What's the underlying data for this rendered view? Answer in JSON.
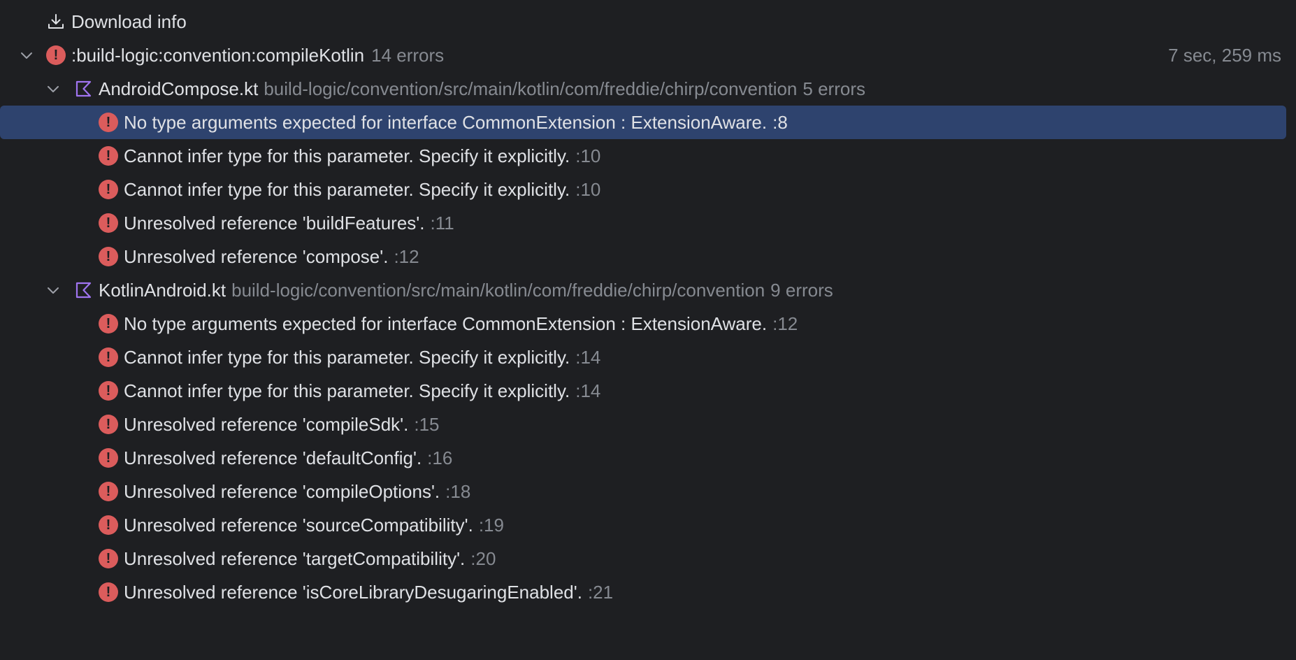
{
  "download": {
    "label": "Download info"
  },
  "task": {
    "name": ":build-logic:convention:compileKotlin",
    "count": "14 errors",
    "duration": "7 sec, 259 ms"
  },
  "files": [
    {
      "name": "AndroidCompose.kt",
      "path": "build-logic/convention/src/main/kotlin/com/freddie/chirp/convention",
      "count": "5 errors",
      "errors": [
        {
          "message": "No type arguments expected for interface CommonExtension : ExtensionAware.",
          "line": ":8"
        },
        {
          "message": "Cannot infer type for this parameter. Specify it explicitly.",
          "line": ":10"
        },
        {
          "message": "Cannot infer type for this parameter. Specify it explicitly.",
          "line": ":10"
        },
        {
          "message": "Unresolved reference 'buildFeatures'.",
          "line": ":11"
        },
        {
          "message": "Unresolved reference 'compose'.",
          "line": ":12"
        }
      ]
    },
    {
      "name": "KotlinAndroid.kt",
      "path": "build-logic/convention/src/main/kotlin/com/freddie/chirp/convention",
      "count": "9 errors",
      "errors": [
        {
          "message": "No type arguments expected for interface CommonExtension : ExtensionAware.",
          "line": ":12"
        },
        {
          "message": "Cannot infer type for this parameter. Specify it explicitly.",
          "line": ":14"
        },
        {
          "message": "Cannot infer type for this parameter. Specify it explicitly.",
          "line": ":14"
        },
        {
          "message": "Unresolved reference 'compileSdk'.",
          "line": ":15"
        },
        {
          "message": "Unresolved reference 'defaultConfig'.",
          "line": ":16"
        },
        {
          "message": "Unresolved reference 'compileOptions'.",
          "line": ":18"
        },
        {
          "message": "Unresolved reference 'sourceCompatibility'.",
          "line": ":19"
        },
        {
          "message": "Unresolved reference 'targetCompatibility'.",
          "line": ":20"
        },
        {
          "message": "Unresolved reference 'isCoreLibraryDesugaringEnabled'.",
          "line": ":21"
        }
      ]
    }
  ],
  "icons": {
    "error": "error-icon",
    "kotlin_file": "kotlin-file-icon",
    "download": "download-icon",
    "chevron": "chevron-down-icon"
  },
  "colors": {
    "background": "#1e1f22",
    "selection": "#2e436e",
    "error": "#db5c5c",
    "kotlin": "#a074f0",
    "text": "#dfe1e5",
    "secondary_text": "#868a91"
  }
}
